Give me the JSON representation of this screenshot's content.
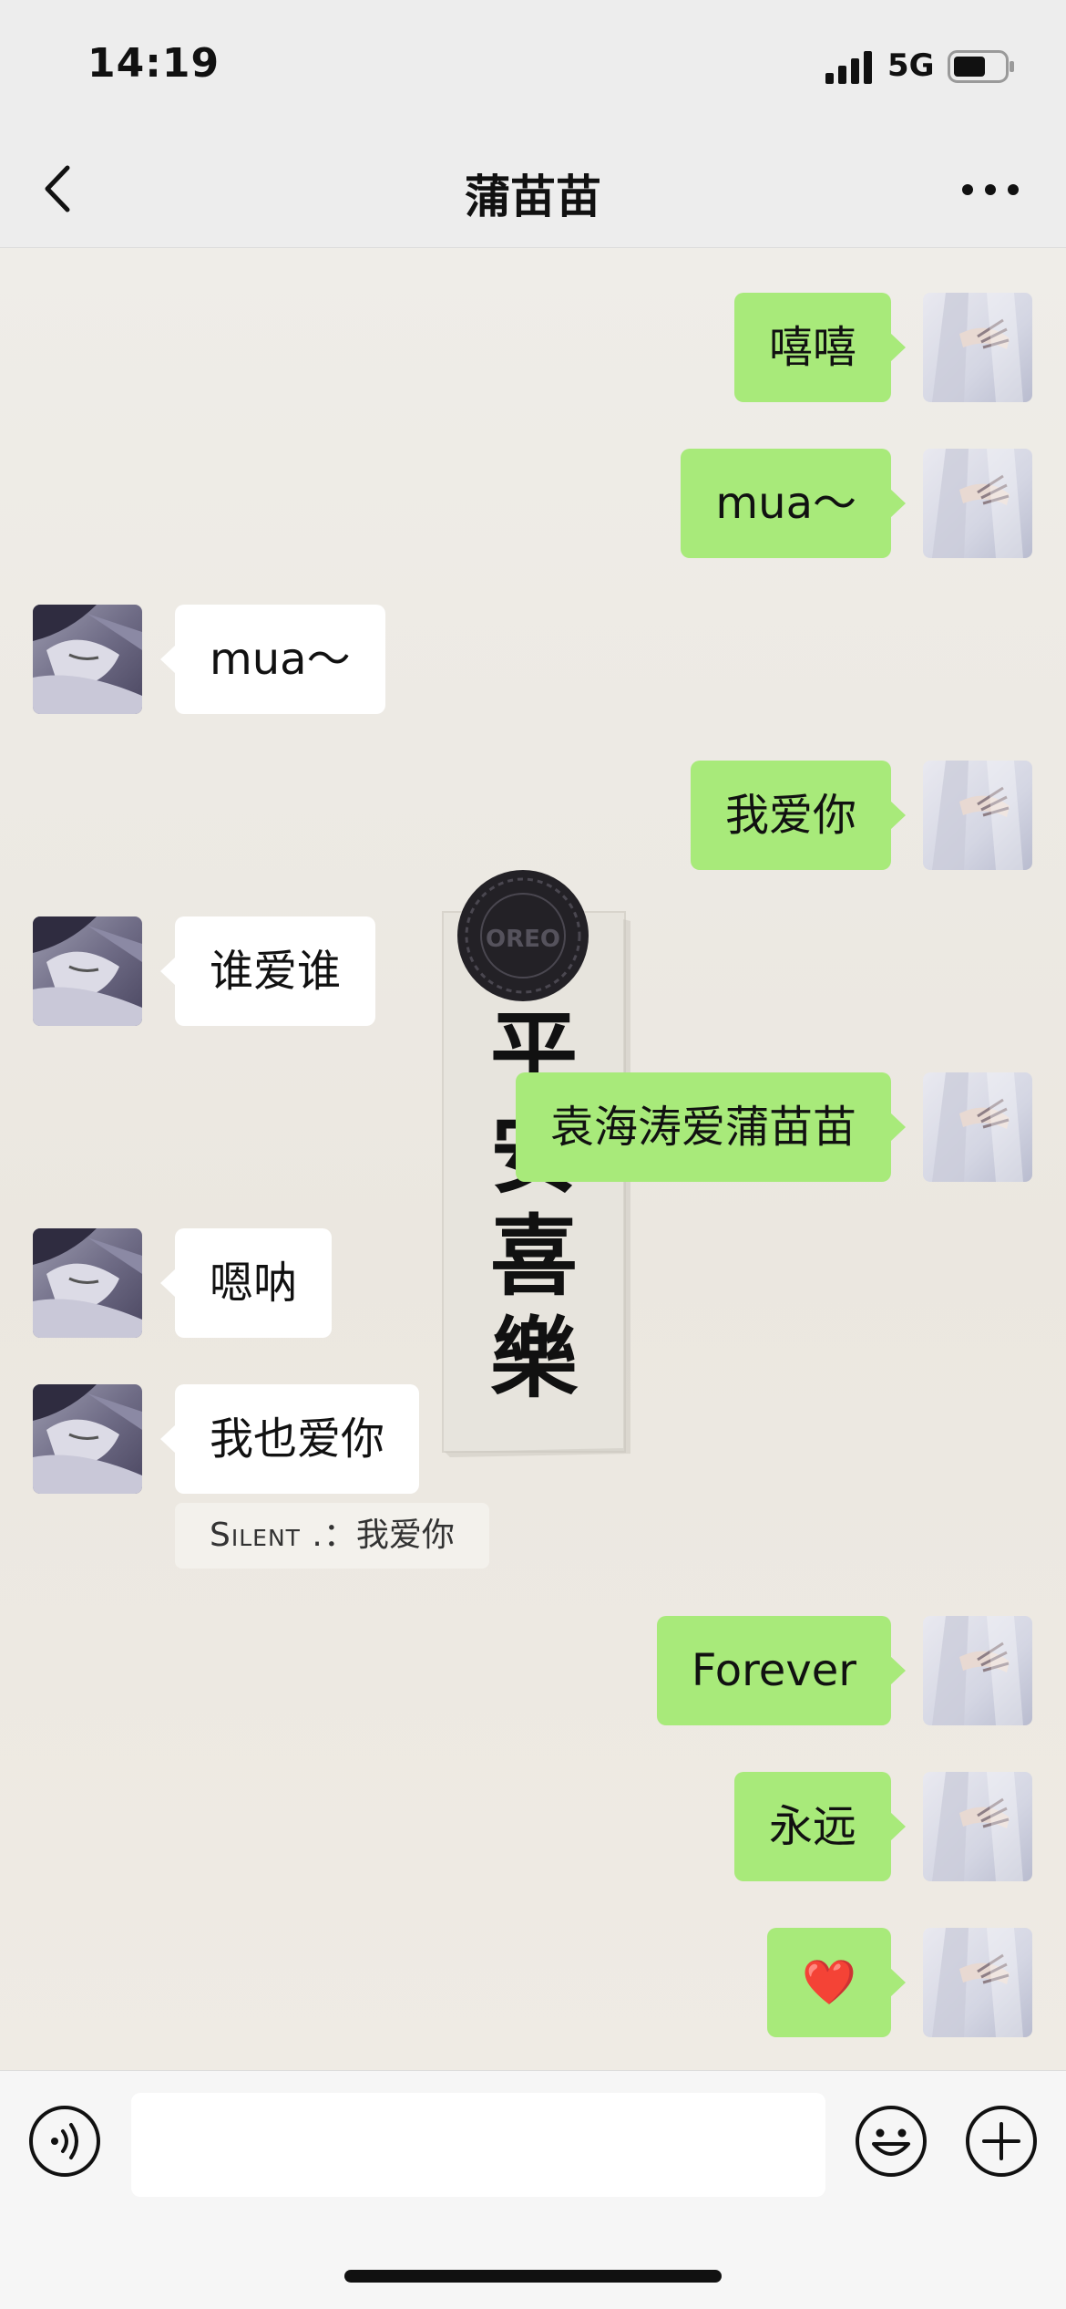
{
  "status_bar": {
    "time": "14:19",
    "network": "5G"
  },
  "header": {
    "title": "蒲苗苗"
  },
  "wallpaper": {
    "cookie_text": "OREO",
    "calligraphy": "平安喜樂"
  },
  "messages": [
    {
      "side": "right",
      "text": "嘻嘻"
    },
    {
      "side": "right",
      "text": "mua～"
    },
    {
      "side": "left",
      "text": "mua～"
    },
    {
      "side": "right",
      "text": "我爱你"
    },
    {
      "side": "left",
      "text": "谁爱谁"
    },
    {
      "side": "right",
      "text": "袁海涛爱蒲苗苗"
    },
    {
      "side": "left",
      "text": "嗯呐"
    },
    {
      "side": "left",
      "text": "我也爱你"
    },
    {
      "side": "right",
      "text": "Forever"
    },
    {
      "side": "right",
      "text": "永远"
    },
    {
      "side": "right",
      "text": "❤️"
    }
  ],
  "quote": {
    "name": "Silent .",
    "separator": "：",
    "text": "我爱你"
  },
  "input": {
    "value": ""
  },
  "colors": {
    "sent_bubble": "#a8ea7a",
    "received_bubble": "#ffffff",
    "background": "#ebe7e0"
  }
}
